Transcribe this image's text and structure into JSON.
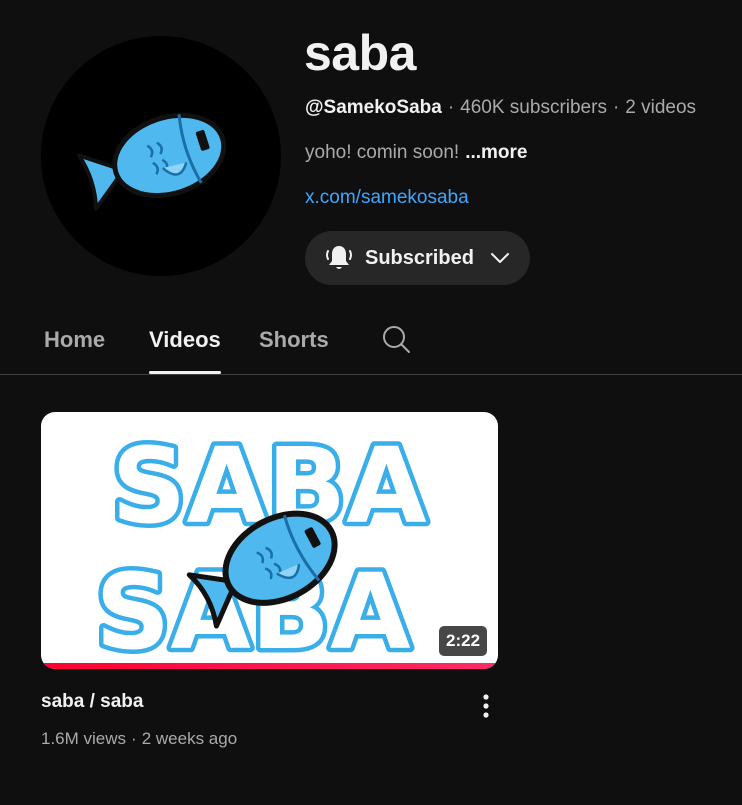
{
  "channel": {
    "name": "saba",
    "handle": "@SamekoSaba",
    "subscribers": "460K subscribers",
    "video_count": "2 videos",
    "separator": "·",
    "description": "yoho! comin soon!",
    "more_label": "...more",
    "link": "x.com/samekosaba",
    "subscribe_label": "Subscribed"
  },
  "tabs": [
    {
      "label": "Home",
      "active": false
    },
    {
      "label": "Videos",
      "active": true
    },
    {
      "label": "Shorts",
      "active": false
    }
  ],
  "videos": [
    {
      "title": "saba / saba",
      "views": "1.6M views",
      "age": "2 weeks ago",
      "duration": "2:22",
      "watched_fraction": 1.0,
      "thumbnail_text": [
        "SABA",
        "SABA"
      ]
    }
  ],
  "icons": {
    "avatar": "fish-icon",
    "bell": "bell-icon",
    "dropdown": "chevron-down-icon",
    "search": "search-icon",
    "menu": "more-vert-icon"
  },
  "colors": {
    "background": "#0f0f0f",
    "link": "#3ea6ff",
    "fish_blue": "#4fb8ee",
    "progress": "#ff0033",
    "chip": "#272727"
  }
}
